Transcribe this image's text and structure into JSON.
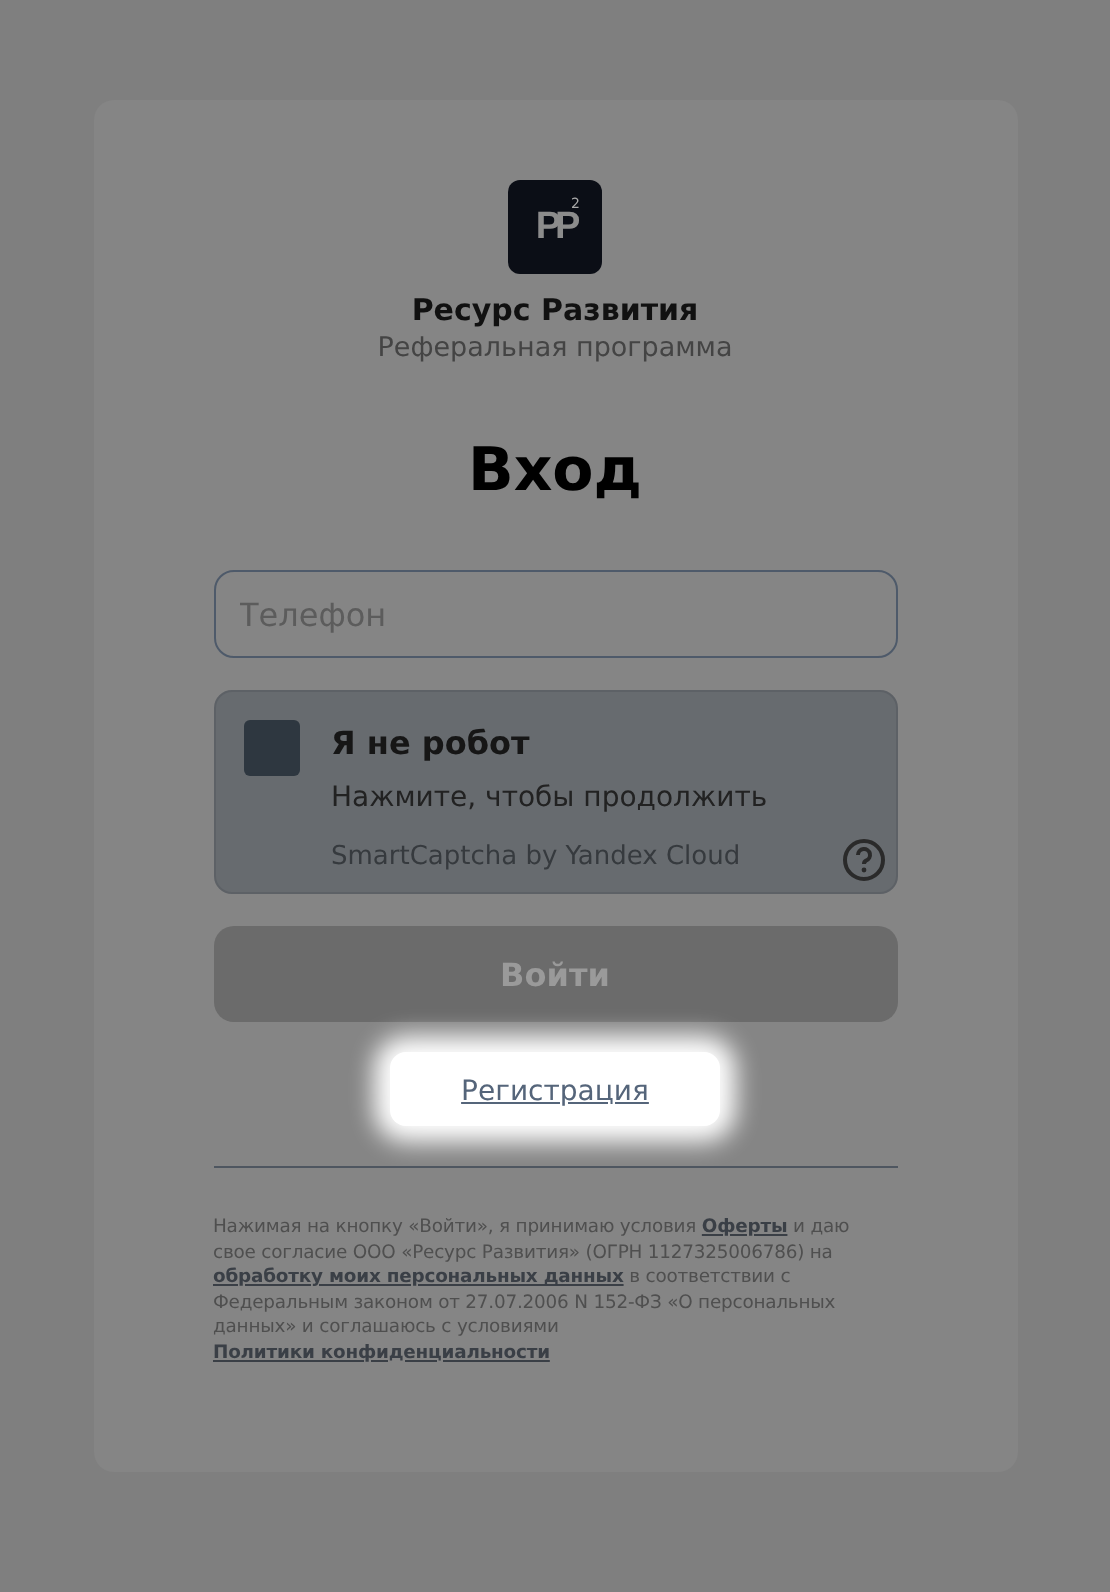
{
  "brand": {
    "logo": {
      "letters": "PP",
      "superscript": "2"
    },
    "name": "Ресурс Развития",
    "subtitle": "Реферальная программа"
  },
  "heading": "Вход",
  "phone_field": {
    "placeholder": "Телефон"
  },
  "captcha": {
    "checked": false,
    "title": "Я не робот",
    "hint": "Нажмите, чтобы продолжить",
    "provider": "SmartCaptcha by Yandex Cloud"
  },
  "login_button": {
    "label": "Войти",
    "disabled": true
  },
  "register_link": {
    "label": "Регистрация",
    "highlighted": true
  },
  "legal": [
    {
      "kind": "plain",
      "text": "Нажимая на кнопку «Войти», я принимаю условия "
    },
    {
      "kind": "link",
      "text": "Оферты"
    },
    {
      "kind": "plain",
      "text": " и даю свое согласие ООО «Ресурс Развития» (ОГРН 1127325006786) на "
    },
    {
      "kind": "link",
      "text": "обработку моих персональных данных"
    },
    {
      "kind": "plain",
      "text": " в соответствии с Федеральным законом от 27.07.2006 N 152-ФЗ «О персональных данных» и соглашаюсь с условиями "
    },
    {
      "kind": "link",
      "text": "Политики конфиденциальности"
    }
  ]
}
